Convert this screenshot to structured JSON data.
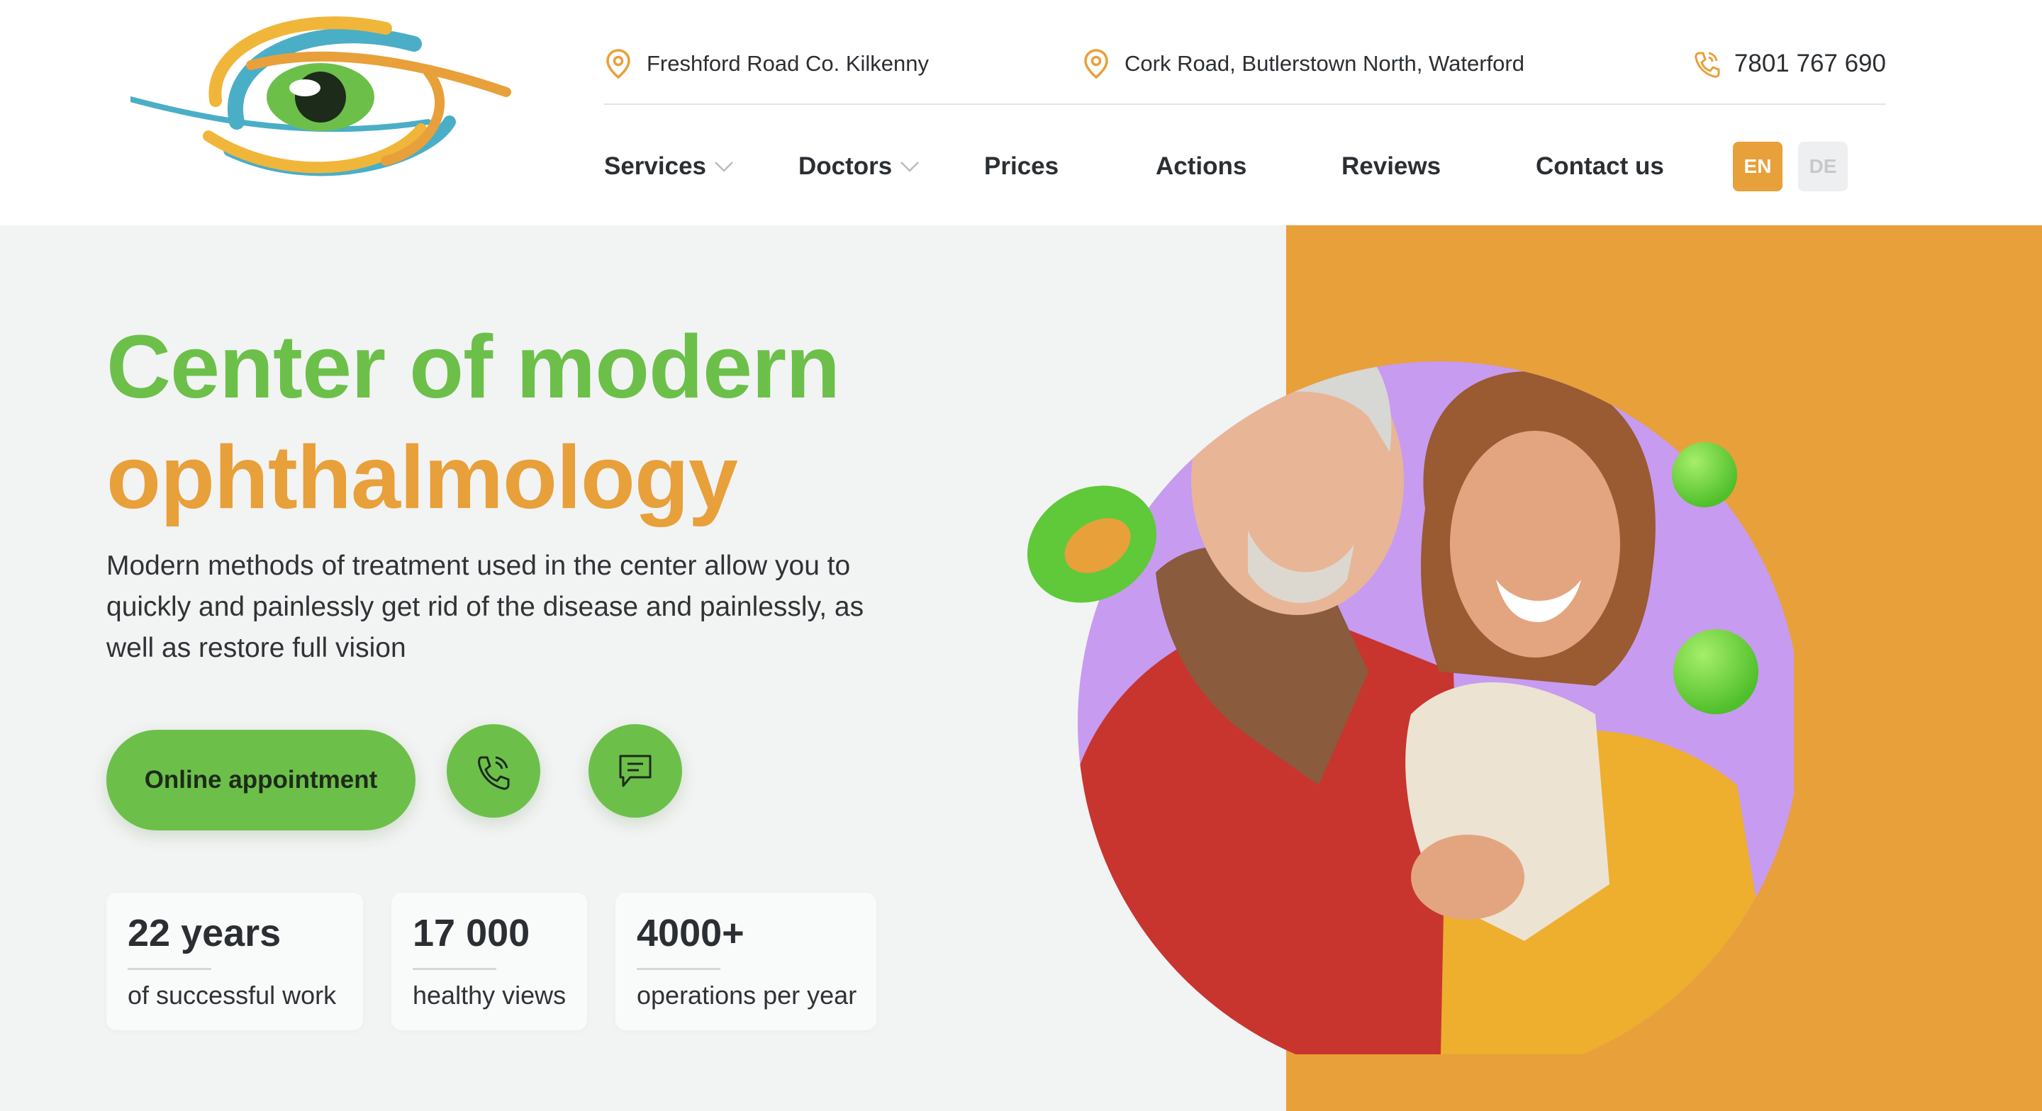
{
  "header": {
    "logo_icon": "eye-logo",
    "addresses": [
      {
        "icon": "location-pin-icon",
        "text": "Freshford Road Co. Kilkenny"
      },
      {
        "icon": "location-pin-icon",
        "text": "Cork Road, Butlerstown North, Waterford"
      }
    ],
    "phone": {
      "icon": "phone-icon",
      "text": "7801 767 690"
    },
    "nav": [
      {
        "label": "Services",
        "has_dropdown": true
      },
      {
        "label": "Doctors",
        "has_dropdown": true
      },
      {
        "label": "Prices",
        "has_dropdown": false
      },
      {
        "label": "Actions",
        "has_dropdown": false
      },
      {
        "label": "Reviews",
        "has_dropdown": false
      },
      {
        "label": "Contact us",
        "has_dropdown": false
      }
    ],
    "languages": [
      {
        "code": "EN",
        "active": true
      },
      {
        "code": "DE",
        "active": false
      }
    ]
  },
  "hero": {
    "title_line1": "Center of modern",
    "title_line2": "ophthalmology",
    "description": "Modern methods of treatment used in the center allow you to quickly and painlessly get rid of the disease and painlessly, as well as restore full vision",
    "appointment_button": "Online appointment",
    "call_button_icon": "phone-icon",
    "chat_button_icon": "chat-icon",
    "stats": [
      {
        "value": "22 years",
        "label": "of successful work"
      },
      {
        "value": "17 000",
        "label": "healthy views"
      },
      {
        "value": "4000+",
        "label": "operations per year"
      }
    ]
  },
  "colors": {
    "brand_green": "#6cc04a",
    "brand_orange": "#e8a03a",
    "logo_blue": "#4aaec7",
    "hero_bg": "#f2f3f3",
    "text_dark": "#2b2f33"
  }
}
